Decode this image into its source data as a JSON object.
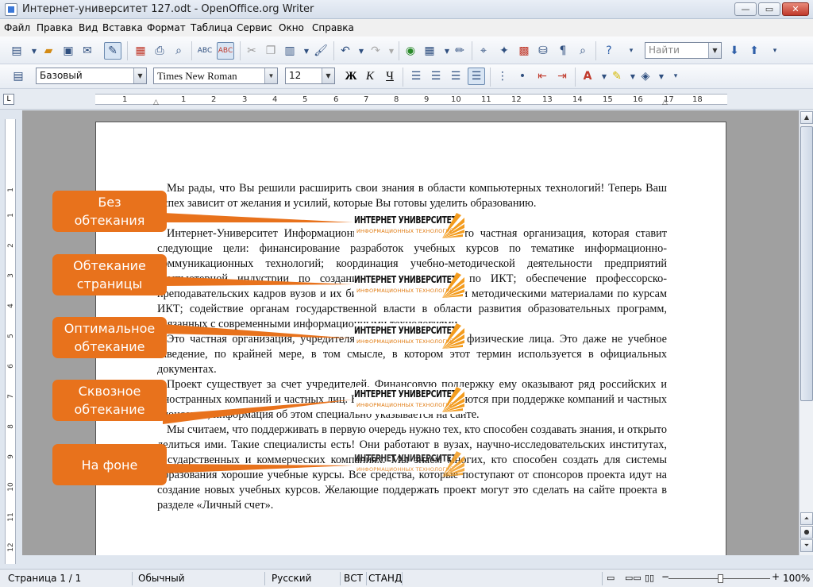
{
  "window": {
    "title": "Интернет-университет 127.odt - OpenOffice.org Writer",
    "minimize": "—",
    "maximize": "▭",
    "close": "✕"
  },
  "menu": [
    "Файл",
    "Правка",
    "Вид",
    "Вставка",
    "Формат",
    "Таблица",
    "Сервис",
    "Окно",
    "Справка"
  ],
  "toolbar": {
    "find_placeholder": "Найти"
  },
  "formatting": {
    "style": "Базовый",
    "font": "Times New Roman",
    "size": "12",
    "bold": "Ж",
    "italic": "К",
    "underline": "Ч"
  },
  "ruler": {
    "marks": [
      "1",
      "1",
      "2",
      "3",
      "4",
      "5",
      "6",
      "7",
      "8",
      "9",
      "10",
      "11",
      "12",
      "13",
      "14",
      "15",
      "16",
      "17",
      "18"
    ],
    "vmarks": [
      "1",
      "1",
      "2",
      "3",
      "4",
      "5",
      "6",
      "7",
      "8",
      "9",
      "10",
      "11",
      "12"
    ]
  },
  "document": {
    "paragraphs": [
      "Мы рады, что Вы решили расширить свои знания в области компьютерных технологий! Теперь Ваш успех зависит от желания и усилий, которые Вы готовы уделить образованию.",
      "Интернет-Университет Информационных Технологий — это частная организация, которая ставит следующие цели: финансирование разработок учебных курсов по тематике информационно-коммуникационных технологий; координация учебно-методической деятельности предприятий компьютерной индустрии по созданию учебных курсов по ИКТ; обеспечение профессорско-преподавательских кадров вузов и их библиотек учебниками и методическими материалами по курсам ИКТ; содействие органам государственной власти в области развития образовательных программ, связанных с современными информационными технологиями.",
      "Это частная организация, учредителями которой являются физические лица. Это даже не учебное заведение, по крайней мере, в том смысле, в котором этот термин используется в официальных документах.",
      "Проект существует за счет учредителей. Финансовую поддержку ему оказывают ряд российских и иностранных компаний и частных лиц. Некоторые курсы создаются при поддержке компаний и частных спонсоров, информация об этом специально указывается на сайте.",
      "Мы считаем, что поддерживать в первую очередь нужно тех, кто способен создавать знания, и открыто делиться ими. Такие специалисты есть! Они работают в вузах, научно-исследовательских институтах, государственных и коммерческих компаниях. Мы знаем многих, кто способен создать для системы образования хорошие учебные курсы. Все средства, которые поступают от спонсоров проекта идут на создание новых учебных курсов. Желающие поддержать проект могут это сделать на сайте проекта в разделе «Личный счет»."
    ]
  },
  "logo": {
    "title": "ИНТЕРНЕТ УНИВЕРСИТЕТ",
    "subtitle": "ИНФОРМАЦИОННЫХ ТЕХНОЛОГИЙ"
  },
  "callouts": [
    {
      "line1": "Без",
      "line2": "обтекания"
    },
    {
      "line1": "Обтекание",
      "line2": "страницы"
    },
    {
      "line1": "Оптимальное",
      "line2": "обтекание"
    },
    {
      "line1": "Сквозное",
      "line2": "обтекание"
    },
    {
      "line1": "На фоне",
      "line2": ""
    }
  ],
  "colors": {
    "callout": "#e8721c",
    "logo_accent": "#f39c1f"
  },
  "status": {
    "page": "Страница  1 / 1",
    "style": "Обычный",
    "language": "Русский",
    "insert": "ВСТ",
    "selection": "СТАНД",
    "zoom": "100%"
  }
}
